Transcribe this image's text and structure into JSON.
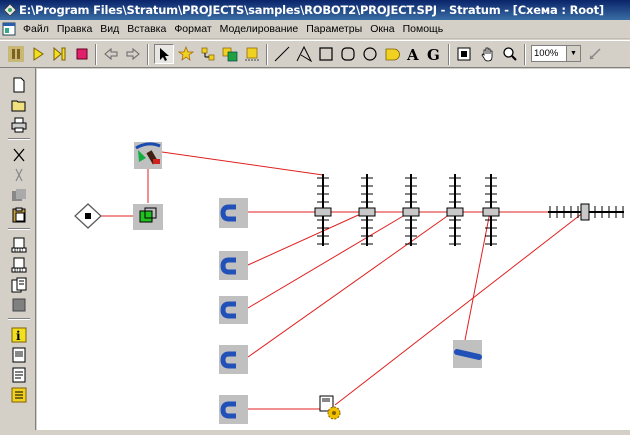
{
  "window": {
    "title": "E:\\Program Files\\Stratum\\PROJECTS\\samples\\ROBOT2\\PROJECT.SPJ - Stratum - [Схема : Root]",
    "app_icon": "stratum-app-icon"
  },
  "menubar": {
    "system_icon": "document-system-icon",
    "items": [
      "Файл",
      "Правка",
      "Вид",
      "Вставка",
      "Формат",
      "Моделирование",
      "Параметры",
      "Окна",
      "Помощь"
    ]
  },
  "toolbar": {
    "buttons": [
      "pause-icon",
      "play-icon",
      "step-icon",
      "stop-icon",
      "back-icon",
      "forward-icon",
      "arrow-select-icon",
      "star-tool-icon",
      "link-tool-icon",
      "image-tool-icon",
      "object-tool-icon",
      "line-tool-icon",
      "polyline-tool-icon",
      "rectangle-tool-icon",
      "ellipse-tool-icon",
      "circle-tool-icon",
      "bitmap-tool-icon",
      "text-a-tool-icon",
      "text-g-tool-icon",
      "frame-tool-icon",
      "hand-pan-icon",
      "zoom-magnifier-icon",
      "edit-pointer-icon"
    ],
    "zoom_value": "100%"
  },
  "left_toolbar": {
    "buttons": [
      "new-file-icon",
      "open-folder-icon",
      "print-icon",
      "cut-icon",
      "copy-icon",
      "paste-icon",
      "clipboard-icon",
      "export-icon",
      "import-icon",
      "properties-icon",
      "blank-icon",
      "info-icon",
      "document-icon",
      "edit-document-icon",
      "notes-icon"
    ]
  },
  "diagram": {
    "colors": {
      "link": "#e02020",
      "node_bg": "#c0c0c0",
      "magnet": "#2050b8",
      "slider": "#000000"
    },
    "nodes": [
      "diamond-start-node",
      "robot-arm-node",
      "green-box-node",
      "magnet-node-1",
      "magnet-node-2",
      "magnet-node-3",
      "magnet-node-4",
      "magnet-node-5",
      "slider-1",
      "slider-2",
      "slider-3",
      "slider-4",
      "slider-5",
      "horizontal-slider",
      "pipe-node",
      "gear-node"
    ]
  }
}
